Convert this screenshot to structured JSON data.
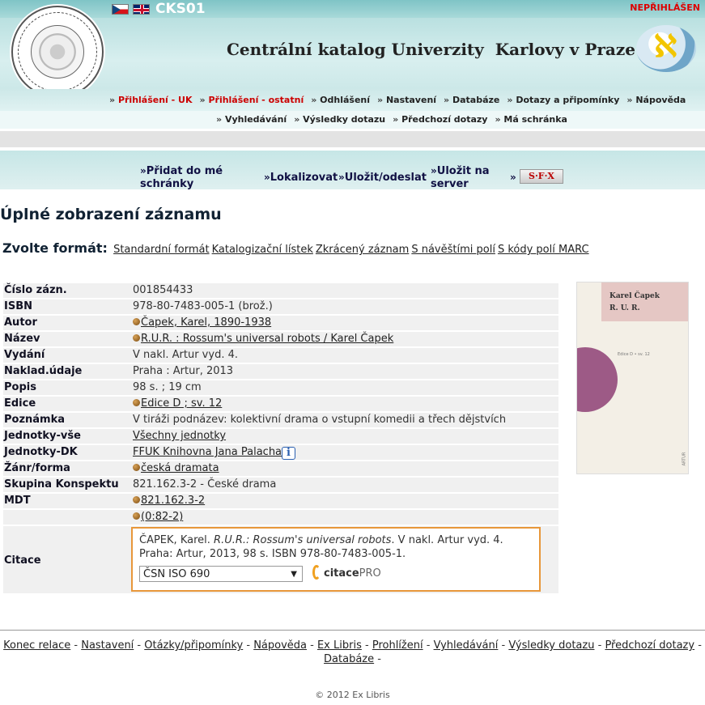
{
  "header": {
    "site_code": "CKS01",
    "login_status": "NEPŘIHLÁŠEN",
    "title": "Centrální katalog Univerzity  Karlovy v Praze"
  },
  "nav": {
    "row1": [
      {
        "label": "Přihlášení - UK",
        "red": true
      },
      {
        "label": "Přihlášení - ostatní",
        "red": true
      },
      {
        "label": "Odhlášení",
        "red": false
      },
      {
        "label": "Nastavení",
        "red": false
      },
      {
        "label": "Databáze",
        "red": false
      },
      {
        "label": "Dotazy a připomínky",
        "red": false
      },
      {
        "label": "Nápověda",
        "red": false
      }
    ],
    "row2": [
      {
        "label": "Vyhledávání"
      },
      {
        "label": "Výsledky dotazu"
      },
      {
        "label": "Předchozí dotazy"
      },
      {
        "label": "Má schránka"
      }
    ]
  },
  "actions": {
    "add_to_basket": "Přidat do mé schránky",
    "localize": "Lokalizovat",
    "save_send": "Uložit/odeslat",
    "save_server": "Uložit na server",
    "sfx": "S·F·X"
  },
  "page": {
    "title": "Úplné zobrazení záznamu",
    "format_label": "Zvolte formát:",
    "formats": [
      "Standardní formát",
      "Katalogizační lístek",
      "Zkrácený záznam",
      "S návěštími polí",
      "S kódy polí MARC"
    ]
  },
  "record": {
    "rows": [
      {
        "label": "Číslo zázn.",
        "value": "001854433",
        "link": false,
        "bullet": false
      },
      {
        "label": "ISBN",
        "value": "978-80-7483-005-1 (brož.)",
        "link": false,
        "bullet": false
      },
      {
        "label": "Autor",
        "value": "Čapek, Karel, 1890-1938",
        "link": true,
        "bullet": true
      },
      {
        "label": "Název",
        "value": "R.U.R. : Rossum's universal robots / Karel Čapek",
        "link": true,
        "bullet": true
      },
      {
        "label": "Vydání",
        "value": "V nakl. Artur vyd. 4.",
        "link": false,
        "bullet": false
      },
      {
        "label": "Naklad.údaje",
        "value": "Praha : Artur, 2013",
        "link": false,
        "bullet": false
      },
      {
        "label": "Popis",
        "value": "98 s. ; 19 cm",
        "link": false,
        "bullet": false
      },
      {
        "label": "Edice",
        "value": "Edice D ; sv. 12",
        "link": true,
        "bullet": true
      },
      {
        "label": "Poznámka",
        "value": "V tiráži podnázev: kolektivní drama o vstupní komedii a třech dějstvích",
        "link": false,
        "bullet": false
      },
      {
        "label": "Jednotky-vše",
        "value": "Všechny jednotky",
        "link": true,
        "bullet": false
      },
      {
        "label": "Jednotky-DK",
        "value": "FFUK Knihovna Jana Palacha",
        "link": true,
        "bullet": false,
        "info": true
      },
      {
        "label": "Žánr/forma",
        "value": "česká dramata",
        "link": true,
        "bullet": true
      },
      {
        "label": "Skupina Konspektu",
        "value": "821.162.3-2 - České drama",
        "link": false,
        "bullet": false
      },
      {
        "label": "MDT",
        "value": "821.162.3-2",
        "link": true,
        "bullet": true
      },
      {
        "label": "",
        "value": "(0:82-2)",
        "link": true,
        "bullet": true
      }
    ],
    "info_glyph": "i"
  },
  "citation": {
    "label": "Citace",
    "author": "ČAPEK, Karel.",
    "title_italic": "R.U.R.: Rossum's universal robots",
    "rest": ". V nakl. Artur vyd. 4. Praha: Artur, 2013, 98 s. ISBN 978-80-7483-005-1.",
    "style_selected": "ČSN ISO 690",
    "provider": "citace",
    "provider_suffix": "PRO"
  },
  "cover": {
    "author": "Karel Čapek",
    "title": "R. U. R.",
    "small_text": "Edice D • sv. 12",
    "spine": "ARTUR"
  },
  "footer": {
    "links": [
      "Konec relace",
      "Nastavení",
      "Otázky/připomínky",
      "Nápověda",
      "Ex Libris",
      "Prohlížení",
      "Vyhledávání",
      "Výsledky dotazu",
      "Předchozí dotazy",
      "Databáze"
    ],
    "copyright": "© 2012 Ex Libris"
  },
  "colors": {
    "header_teal": "#a8d9d9",
    "login_red": "#dd0000",
    "citation_border": "#e8973a"
  }
}
